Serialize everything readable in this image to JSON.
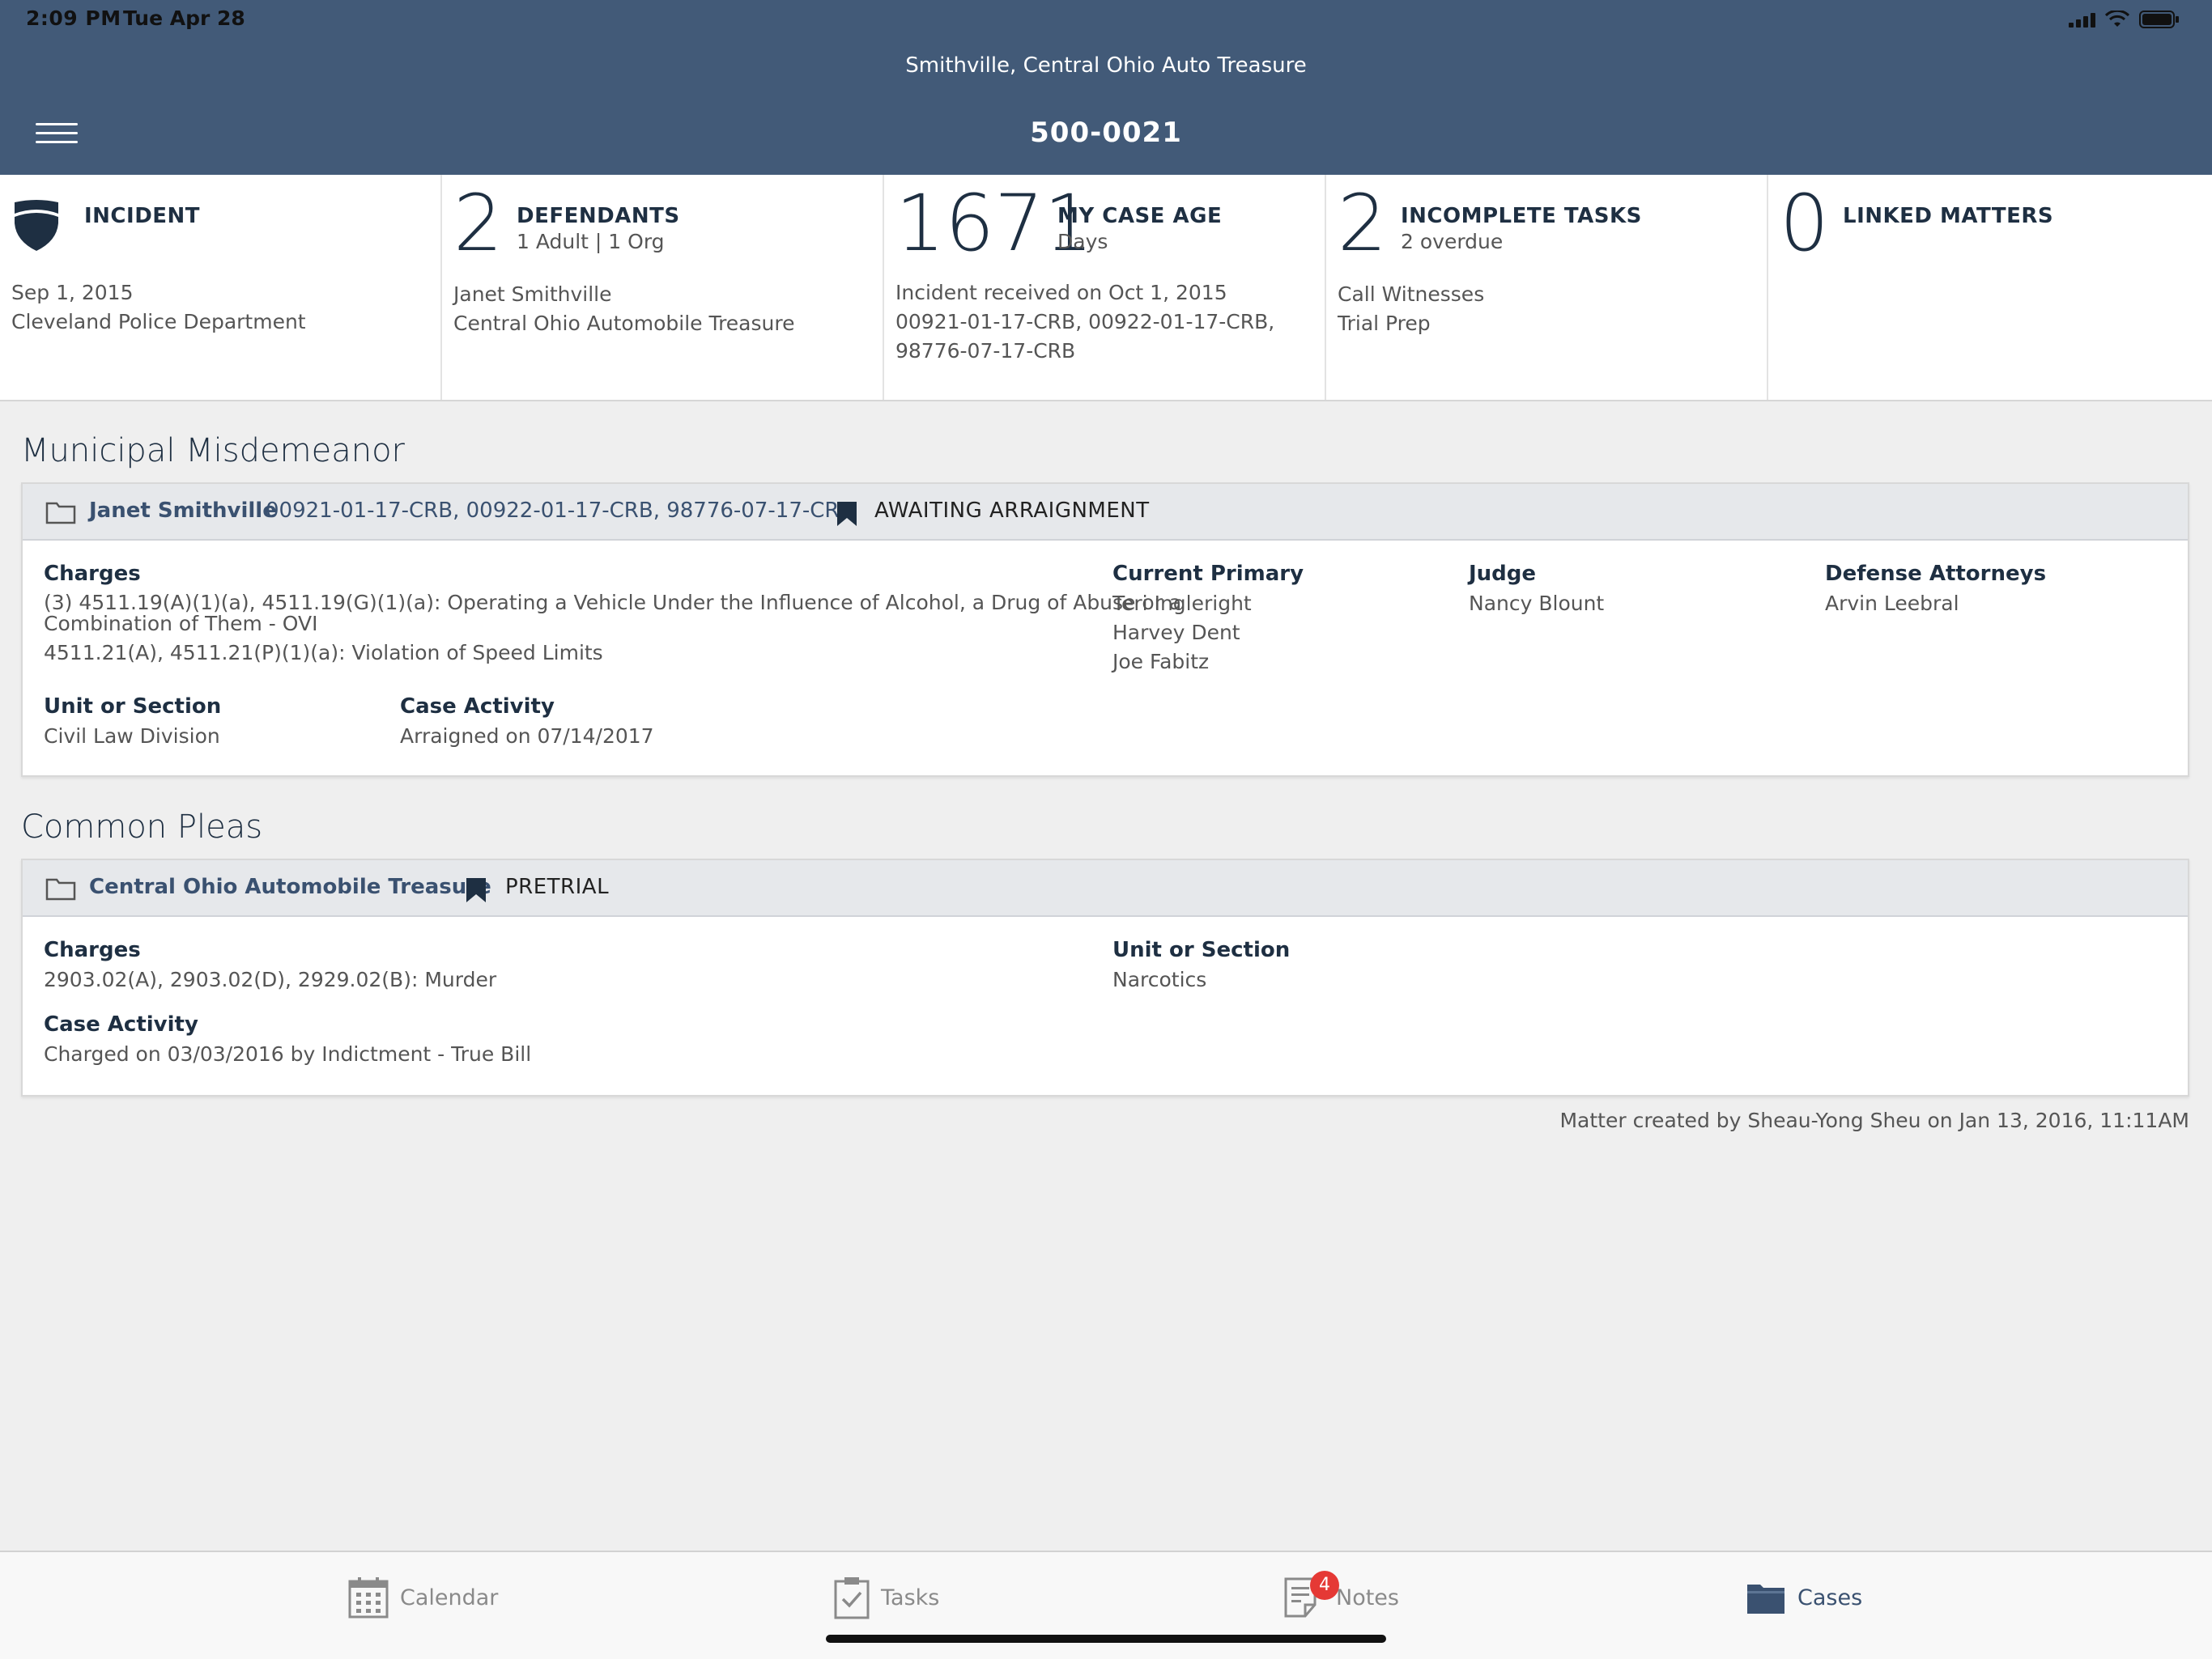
{
  "status_bar": {
    "time": "2:09 PM",
    "date": "Tue Apr 28"
  },
  "header": {
    "org_title": "Smithville, Central Ohio Auto Treasure",
    "case_number": "500-0021"
  },
  "summary": {
    "incident": {
      "label": "INCIDENT",
      "line1": "Sep 1, 2015",
      "line2": "Cleveland Police Department"
    },
    "defendants": {
      "count": "2",
      "label": "DEFENDANTS",
      "sub": "1 Adult | 1 Org",
      "line1": "Janet Smithville",
      "line2": "Central Ohio Automobile Treasure"
    },
    "case_age": {
      "count": "1671",
      "label": "MY CASE AGE",
      "sub": "Days",
      "line1": "Incident received on Oct 1, 2015",
      "line2": "00921-01-17-CRB, 00922-01-17-CRB,",
      "line3": "98776-07-17-CRB"
    },
    "tasks": {
      "count": "2",
      "label": "INCOMPLETE TASKS",
      "sub": "2 overdue",
      "line1": "Call Witnesses",
      "line2": "Trial Prep"
    },
    "linked": {
      "count": "0",
      "label": "LINKED MATTERS"
    }
  },
  "sections": {
    "municipal": {
      "title": "Municipal Misdemeanor",
      "party": "Janet Smithville",
      "case_numbers": "00921-01-17-CRB, 00922-01-17-CRB, 98776-07-17-CRB",
      "status": "AWAITING ARRAIGNMENT",
      "charges_label": "Charges",
      "charges_line1": "(3) 4511.19(A)(1)(a), 4511.19(G)(1)(a): Operating a Vehicle Under the Influence of Alcohol, a Drug of Abuse or a",
      "charges_line2": "Combination of Them - OVI",
      "charges_line3": "4511.21(A), 4511.21(P)(1)(a): Violation of Speed Limits",
      "primary_label": "Current Primary",
      "primary": [
        "Teri Ingleright",
        "Harvey Dent",
        "Joe Fabitz"
      ],
      "judge_label": "Judge",
      "judge": "Nancy Blount",
      "defense_label": "Defense Attorneys",
      "defense": "Arvin Leebral",
      "unit_label": "Unit or Section",
      "unit": "Civil Law Division",
      "activity_label": "Case Activity",
      "activity": "Arraigned on 07/14/2017"
    },
    "common": {
      "title": "Common Pleas",
      "party": "Central Ohio Automobile Treasure",
      "status": "PRETRIAL",
      "charges_label": "Charges",
      "charges": "2903.02(A), 2903.02(D), 2929.02(B): Murder",
      "unit_label": "Unit or Section",
      "unit": "Narcotics",
      "activity_label": "Case Activity",
      "activity": "Charged on 03/03/2016 by Indictment - True Bill"
    }
  },
  "footer_note": "Matter created by Sheau-Yong Sheu on Jan 13, 2016, 11:11AM",
  "tabbar": {
    "calendar": "Calendar",
    "tasks": "Tasks",
    "notes": "Notes",
    "notes_badge": "4",
    "cases": "Cases",
    "active_color": "#3a5170",
    "inactive_color": "#8a8a8a"
  }
}
